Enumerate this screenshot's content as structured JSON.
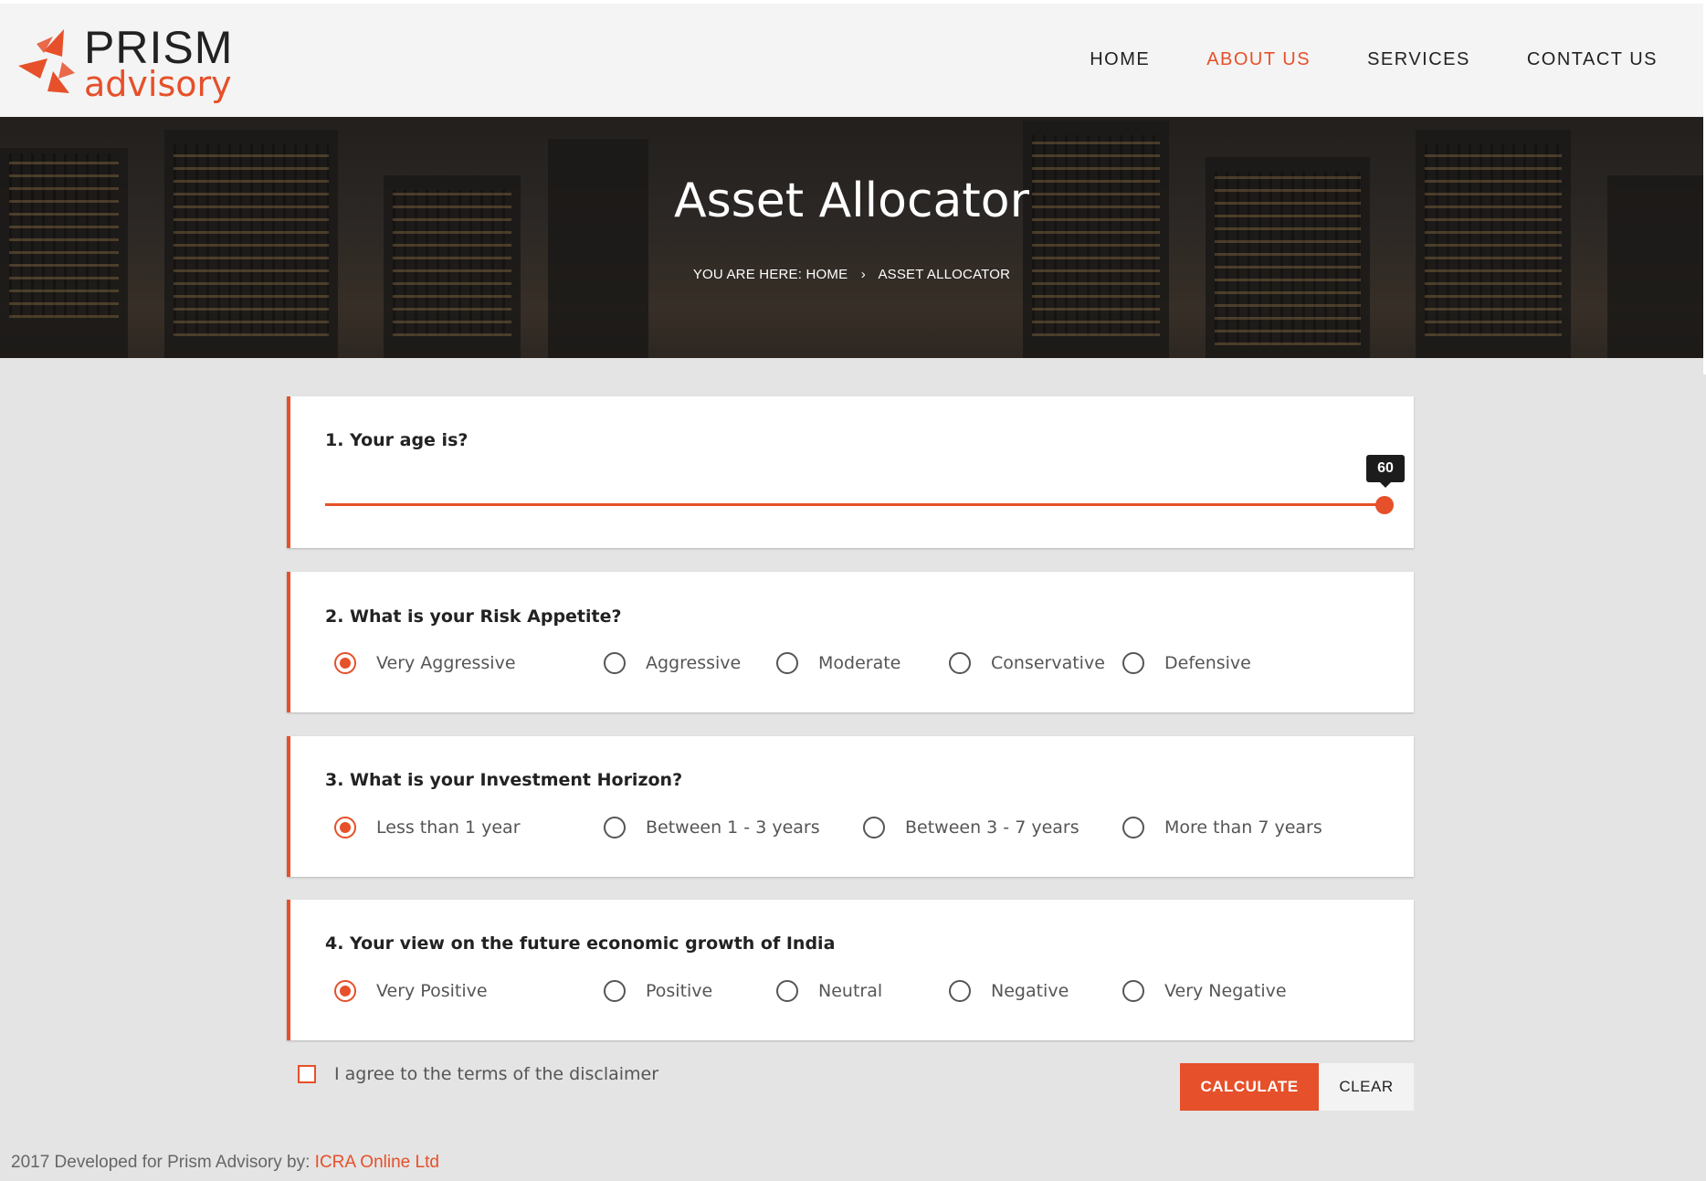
{
  "brand": {
    "name": "PRISM",
    "sub": "advisory",
    "accent": "#e6502a"
  },
  "nav": [
    {
      "label": "HOME",
      "active": false
    },
    {
      "label": "ABOUT US",
      "active": true
    },
    {
      "label": "SERVICES",
      "active": false
    },
    {
      "label": "CONTACT US",
      "active": false
    }
  ],
  "hero": {
    "title": "Asset Allocator",
    "crumb_prefix": "YOU ARE HERE:",
    "crumb_home": "HOME",
    "crumb_sep": "›",
    "crumb_current": "ASSET ALLOCATOR"
  },
  "questions": {
    "age": {
      "label": "1. Your age is?",
      "value": "60"
    },
    "risk": {
      "label": "2. What is your Risk Appetite?",
      "options": [
        "Very Aggressive",
        "Aggressive",
        "Moderate",
        "Conservative",
        "Defensive"
      ],
      "selected": "Very Aggressive"
    },
    "horizon": {
      "label": "3. What is your Investment Horizon?",
      "options": [
        "Less than 1 year",
        "Between 1 - 3 years",
        "Between 3 - 7 years",
        "More than 7 years"
      ],
      "selected": "Less than 1 year"
    },
    "growth": {
      "label": "4. Your view on the future economic growth of India",
      "options": [
        "Very Positive",
        "Positive",
        "Neutral",
        "Negative",
        "Very Negative"
      ],
      "selected": "Very Positive"
    }
  },
  "agree": {
    "label": "I agree to the terms of the disclaimer",
    "checked": false
  },
  "buttons": {
    "calculate": "CALCULATE",
    "clear": "CLEAR"
  },
  "footer": {
    "text": "2017 Developed for Prism Advisory by: ",
    "link": "ICRA Online Ltd"
  }
}
